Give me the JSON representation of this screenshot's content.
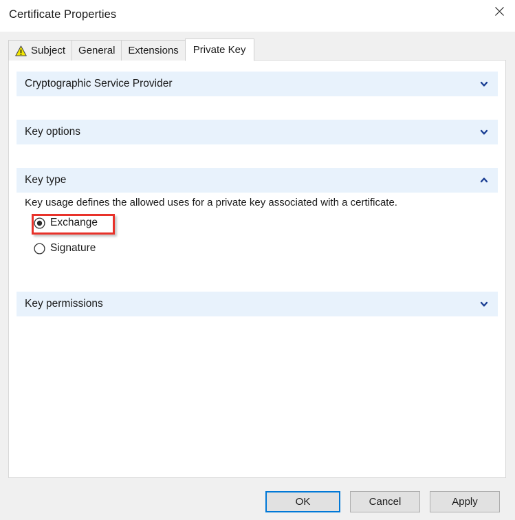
{
  "window": {
    "title": "Certificate Properties",
    "close_icon": "close-icon"
  },
  "tabs": [
    {
      "label": "Subject",
      "icon": "warning-triangle-icon",
      "selected": false
    },
    {
      "label": "General",
      "icon": null,
      "selected": false
    },
    {
      "label": "Extensions",
      "icon": null,
      "selected": false
    },
    {
      "label": "Private Key",
      "icon": null,
      "selected": true
    }
  ],
  "sections": [
    {
      "title": "Cryptographic Service Provider",
      "expanded": false,
      "chevron": "chevron-down-icon"
    },
    {
      "title": "Key options",
      "expanded": false,
      "chevron": "chevron-down-icon"
    },
    {
      "title": "Key type",
      "expanded": true,
      "chevron": "chevron-up-icon",
      "description": "Key usage defines the allowed uses for a private key associated with a certificate.",
      "radios": [
        {
          "label": "Exchange",
          "checked": true,
          "highlighted": true
        },
        {
          "label": "Signature",
          "checked": false,
          "highlighted": false
        }
      ]
    },
    {
      "title": "Key permissions",
      "expanded": false,
      "chevron": "chevron-down-icon"
    }
  ],
  "footer": {
    "ok_label": "OK",
    "cancel_label": "Cancel",
    "apply_label": "Apply",
    "default_button": "OK"
  },
  "colors": {
    "section_header_bg": "#e8f2fc",
    "chevron": "#1b3f94",
    "accent_focus": "#0078d7",
    "highlight_box": "#e8322a",
    "dialog_bg": "#f0f0f0",
    "panel_bg": "#ffffff"
  }
}
